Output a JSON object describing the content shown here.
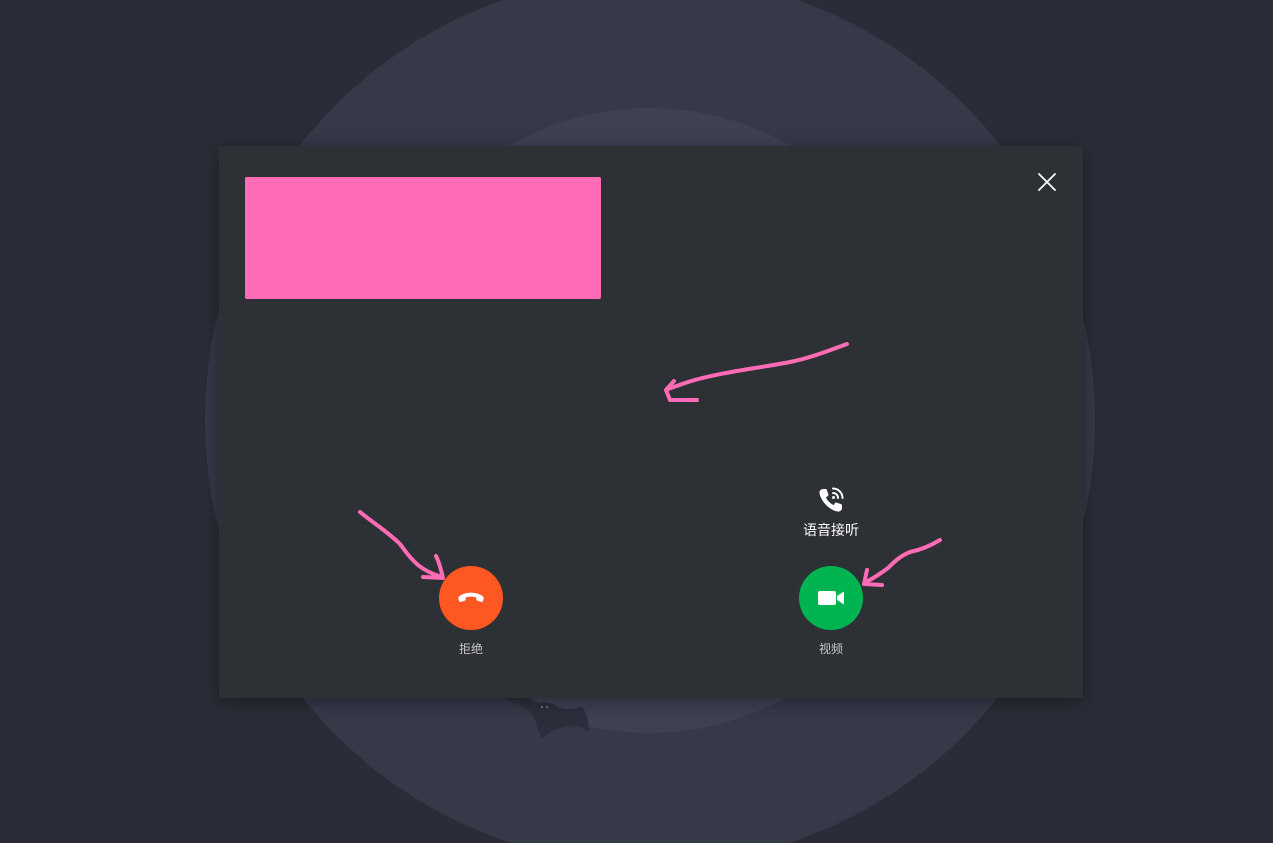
{
  "dialog": {
    "close_icon": "close-icon",
    "redaction_color": "#ff6cb5"
  },
  "actions": {
    "reject": {
      "label": "拒绝",
      "icon": "hang-up-icon",
      "color": "#ff5722"
    },
    "voice_answer": {
      "label": "语音接听",
      "icon": "phone-ringing-icon"
    },
    "video": {
      "label": "视频",
      "icon": "video-camera-icon",
      "color": "#00b451"
    }
  },
  "annotations": {
    "color": "#ff6cb5",
    "arrows": [
      "arrow-to-dialog-center",
      "arrow-to-reject-button",
      "arrow-to-video-button"
    ]
  }
}
